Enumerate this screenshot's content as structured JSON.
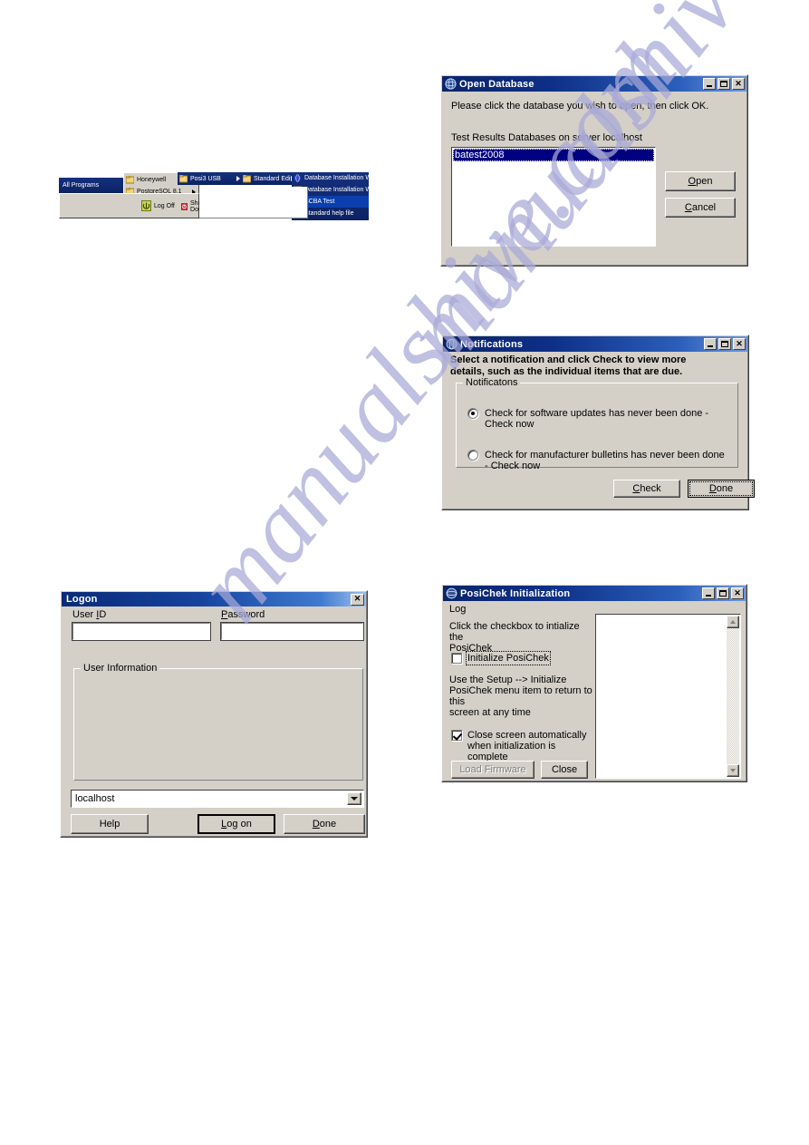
{
  "watermark": {
    "line1": "manualshive.com",
    "line2": "manualshive.com"
  },
  "start_menu": {
    "all_programs": "All Programs",
    "items": [
      {
        "label": "Honeywell",
        "has_submenu": true
      },
      {
        "label": "PostgreSQL 8.1",
        "has_submenu": true
      }
    ],
    "level2": [
      {
        "label": "Posi3 USB",
        "has_submenu": true
      }
    ],
    "level3": [
      {
        "label": "Standard Edition",
        "has_submenu": true
      }
    ],
    "level4": [
      {
        "label": "Database Installation Wizard",
        "selected": false,
        "icon": "globe-icon"
      },
      {
        "label": "Database Installation Wizard Help",
        "selected": false,
        "icon": "help-icon"
      },
      {
        "label": "SCBA Test",
        "selected": true,
        "icon": "app-icon"
      },
      {
        "label": "Standard help file",
        "selected": false,
        "icon": "help-icon"
      }
    ],
    "taskbar_actions": [
      {
        "label": "Log Off",
        "icon": "logoff-icon"
      },
      {
        "label": "Shut Down",
        "icon": "shutdown-icon"
      }
    ]
  },
  "open_database": {
    "title": "Open Database",
    "instruction": "Please click the database you wish to open, then click OK.",
    "list_label": "Test Results Databases on server localhost",
    "list_items": [
      "batest2008"
    ],
    "selected_item": "batest2008",
    "buttons": {
      "open": "Open",
      "cancel": "Cancel"
    },
    "window_controls": {
      "minimize": "minimize-icon",
      "maximize": "maximize-icon",
      "close": "close-icon"
    }
  },
  "notifications": {
    "title": "Notifications",
    "instruction_line1": "Select a notification and click Check to view more",
    "instruction_line2": "details, such as the individual items that are due.",
    "group_legend": "Notificatons",
    "options": [
      {
        "label": "Check for software updates has never been done - Check now",
        "selected": true
      },
      {
        "label": "Check for manufacturer bulletins has never been done - Check now",
        "selected": false
      }
    ],
    "buttons": {
      "check": "Check",
      "done": "Done"
    }
  },
  "logon": {
    "title": "Logon",
    "user_id_label": "User ID",
    "password_label": "Password",
    "user_id_value": "",
    "password_value": "",
    "group_legend": "User Information",
    "server_value": "localhost",
    "buttons": {
      "help": "Help",
      "log_on": "Log on",
      "done": "Done"
    }
  },
  "posichek": {
    "title": "PosiChek Initialization",
    "menu": "Log",
    "instruction_line1": "Click the checkbox to intialize the",
    "instruction_line2": "PosiChek",
    "checkbox_init": {
      "label": "Initialize PosiChek",
      "checked": false
    },
    "note_line1": "Use the Setup --> Initialize",
    "note_line2": "PosiChek menu item to return to this",
    "note_line3": "screen at any time",
    "checkbox_close": {
      "label_line1": "Close screen automatically",
      "label_line2": "when initialization is complete",
      "checked": true
    },
    "buttons": {
      "load_firmware": "Load Firmware",
      "close": "Close"
    },
    "log_text": ""
  },
  "colors": {
    "titlebar_start": "#0a246a",
    "titlebar_end": "#6d96dd",
    "face": "#d4d0c8",
    "selection": "#000080",
    "watermark": "#a9a9d8"
  }
}
